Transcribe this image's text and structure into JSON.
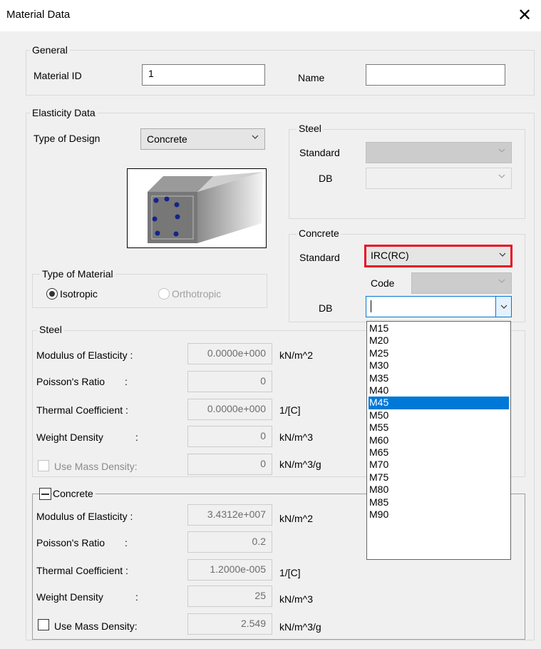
{
  "window": {
    "title": "Material Data",
    "close_glyph": "✕"
  },
  "general": {
    "legend": "General",
    "material_id_label": "Material ID",
    "material_id_value": "1",
    "name_label": "Name",
    "name_value": ""
  },
  "elasticity": {
    "legend": "Elasticity Data",
    "type_of_design_label": "Type of Design",
    "type_of_design_value": "Concrete"
  },
  "steel_std": {
    "legend": "Steel",
    "standard_label": "Standard",
    "db_label": "DB"
  },
  "concrete_std": {
    "legend": "Concrete",
    "standard_label": "Standard",
    "standard_value": "IRC(RC)",
    "code_label": "Code",
    "db_label": "DB",
    "db_value": "",
    "db_options": [
      "M15",
      "M20",
      "M25",
      "M30",
      "M35",
      "M40",
      "M45",
      "M50",
      "M55",
      "M60",
      "M65",
      "M70",
      "M75",
      "M80",
      "M85",
      "M90"
    ],
    "db_highlighted": "M45"
  },
  "type_of_material": {
    "legend": "Type of Material",
    "isotropic": "Isotropic",
    "orthotropic": "Orthotropic"
  },
  "steel_props": {
    "legend": "Steel",
    "modulus_label": "Modulus of Elasticity :",
    "modulus_value": "0.0000e+000",
    "modulus_unit": "kN/m^2",
    "poisson_label": "Poisson's Ratio",
    "poisson_colon": ":",
    "poisson_value": "0",
    "thermal_label": "Thermal Coefficient :",
    "thermal_value": "0.0000e+000",
    "thermal_unit": "1/[C]",
    "weight_label": "Weight Density",
    "weight_colon": ":",
    "weight_value": "0",
    "weight_unit": "kN/m^3",
    "mass_label": "Use Mass Density:",
    "mass_value": "0",
    "mass_unit": "kN/m^3/g"
  },
  "concrete_props": {
    "legend": "Concrete",
    "modulus_label": "Modulus of Elasticity :",
    "modulus_value": "3.4312e+007",
    "modulus_unit": "kN/m^2",
    "poisson_label": "Poisson's Ratio",
    "poisson_colon": ":",
    "poisson_value": "0.2",
    "thermal_label": "Thermal Coefficient :",
    "thermal_value": "1.2000e-005",
    "thermal_unit": "1/[C]",
    "weight_label": "Weight Density",
    "weight_colon": ":",
    "weight_value": "25",
    "weight_unit": "kN/m^3",
    "mass_label": "Use Mass Density:",
    "mass_value": "2.549",
    "mass_unit": "kN/m^3/g"
  },
  "colors": {
    "highlight_border": "#e81123",
    "selection": "#0078d7"
  }
}
